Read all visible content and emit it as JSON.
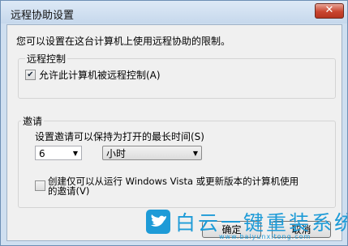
{
  "window": {
    "title": "远程协助设置",
    "close_label": "✕"
  },
  "description": "您可以设置在这台计算机上使用远程协助的限制。",
  "remote_control": {
    "group_label": "远程控制",
    "allow_checkbox": {
      "label": "允许此计算机被远程控制(A)",
      "checked": true
    }
  },
  "invitations": {
    "group_label": "邀请",
    "max_time_label": "设置邀请可以保持为打开的最长时间(S)",
    "duration_value": "6",
    "unit_value": "小时",
    "vista_checkbox": {
      "label_line1": "创建仅可以从运行 Windows Vista 或更新版本的计算机使用",
      "label_line2": "的邀请(V)",
      "checked": false
    }
  },
  "buttons": {
    "ok_label": "确定",
    "cancel_label": "取消"
  },
  "watermark": {
    "title": "白云一键重装系统",
    "url": "www.baiyunxitong.com"
  }
}
